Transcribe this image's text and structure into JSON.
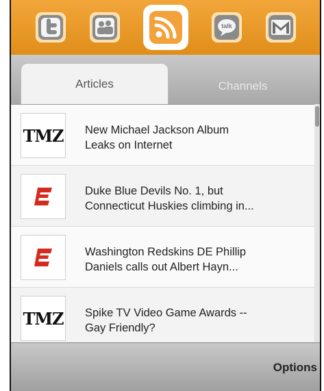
{
  "appbar": {
    "apps": [
      {
        "icon": "twitter-icon"
      },
      {
        "icon": "facebook-icon"
      },
      {
        "icon": "rss-icon",
        "active": true
      },
      {
        "icon": "talk-icon"
      },
      {
        "icon": "gmail-icon"
      }
    ],
    "talk_label": "talk"
  },
  "tabs": {
    "articles": "Articles",
    "channels": "Channels"
  },
  "articles": [
    {
      "source": "TMZ",
      "title_line1": "New Michael Jackson Album",
      "title_line2": "Leaks on Internet"
    },
    {
      "source": "ESPN",
      "title_line1": "Duke Blue Devils No. 1, but",
      "title_line2": "Connecticut Huskies climbing in..."
    },
    {
      "source": "ESPN",
      "title_line1": "Washington Redskins DE Phillip",
      "title_line2": "Daniels calls out Albert Hayn..."
    },
    {
      "source": "TMZ",
      "title_line1": "Spike TV Video Game Awards --",
      "title_line2": "Gay Friendly?"
    }
  ],
  "bottombar": {
    "options_label": "Options"
  },
  "colors": {
    "accent": "#e8961f",
    "espn_red": "#d42b1e"
  }
}
